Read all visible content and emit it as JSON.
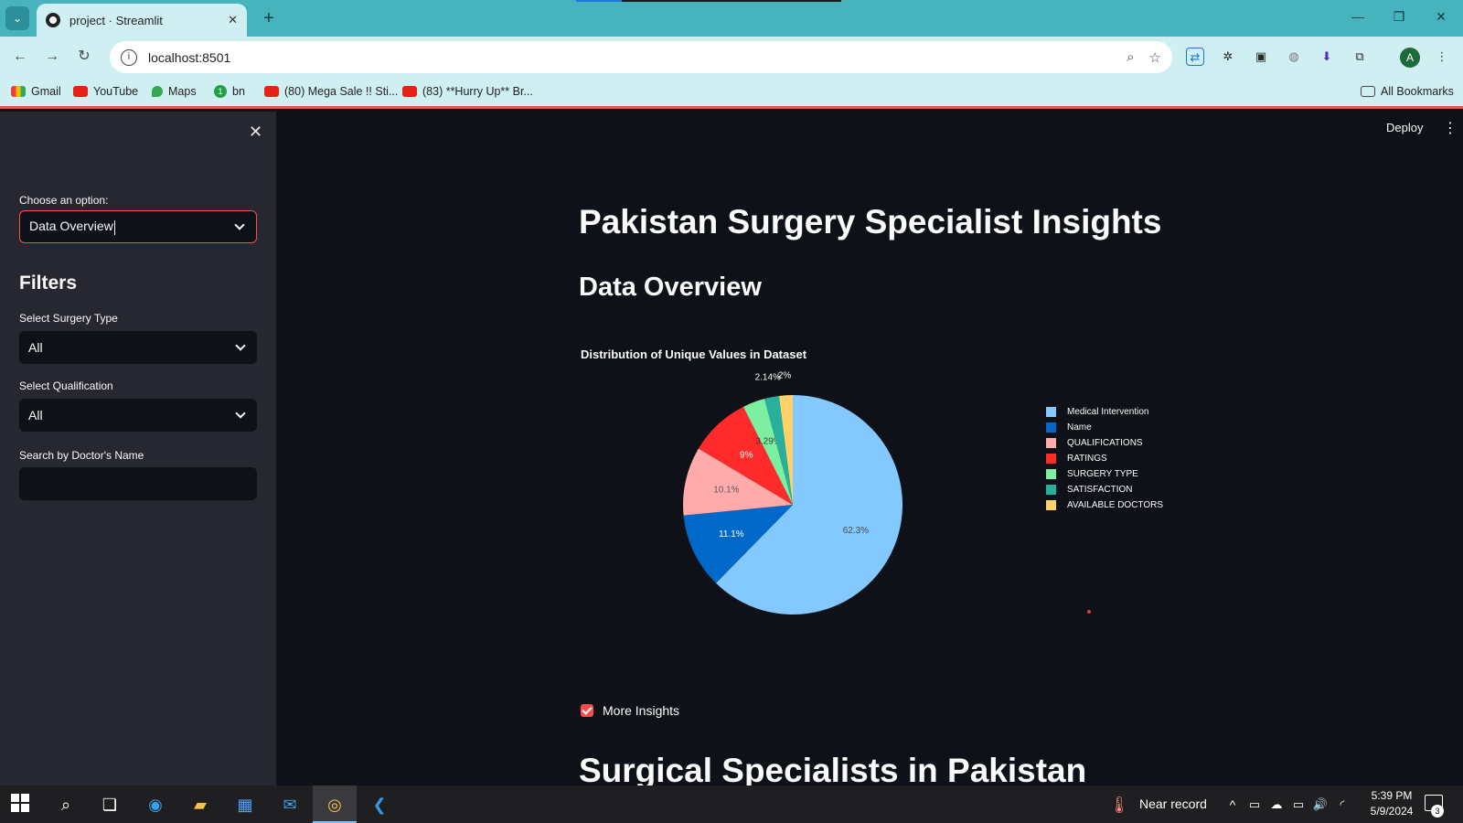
{
  "browser": {
    "tab_title": "project · Streamlit",
    "url": "localhost:8501",
    "bookmarks": [
      {
        "label": "Gmail",
        "icon": "gmail-icon"
      },
      {
        "label": "YouTube",
        "icon": "youtube-icon"
      },
      {
        "label": "Maps",
        "icon": "maps-icon"
      },
      {
        "label": "bn",
        "icon": "one-icon"
      },
      {
        "label": "(80) Mega Sale !! Sti...",
        "icon": "youtube-icon"
      },
      {
        "label": "(83) **Hurry Up** Br...",
        "icon": "youtube-icon"
      }
    ],
    "all_bookmarks": "All Bookmarks",
    "profile_initial": "A",
    "accent": "#46b3bd"
  },
  "sidebar": {
    "choose_label": "Choose an option:",
    "choose_value": "Data Overview",
    "filters_heading": "Filters",
    "surgery_label": "Select Surgery Type",
    "surgery_value": "All",
    "qualification_label": "Select Qualification",
    "qualification_value": "All",
    "search_label": "Search by Doctor's Name",
    "search_value": ""
  },
  "header": {
    "deploy_label": "Deploy"
  },
  "main": {
    "title": "Pakistan Surgery Specialist Insights",
    "subtitle": "Data Overview",
    "checkbox_label": "More Insights",
    "checkbox_checked": true,
    "next_heading": "Surgical Specialists in Pakistan"
  },
  "chart_data": {
    "type": "pie",
    "title": "Distribution of Unique Values in Dataset",
    "legend_position": "right",
    "slices": [
      {
        "label": "Medical Intervention",
        "value": 62.3,
        "text": "62.3%",
        "color": "#83c9ff"
      },
      {
        "label": "Name",
        "value": 11.1,
        "text": "11.1%",
        "color": "#0068c9"
      },
      {
        "label": "QUALIFICATIONS",
        "value": 10.1,
        "text": "10.1%",
        "color": "#ffabab"
      },
      {
        "label": "RATINGS",
        "value": 9.0,
        "text": "9%",
        "color": "#ff2b2b"
      },
      {
        "label": "SURGERY TYPE",
        "value": 3.29,
        "text": "3.29%",
        "color": "#7defa1"
      },
      {
        "label": "SATISFACTION",
        "value": 2.14,
        "text": "2.14%",
        "color": "#29b09d"
      },
      {
        "label": "AVAILABLE DOCTORS",
        "value": 2.0,
        "text": "2%",
        "color": "#ffd16a"
      }
    ]
  },
  "taskbar": {
    "weather_text": "Near record",
    "time": "5:39 PM",
    "date": "5/9/2024",
    "notification_count": "3"
  }
}
